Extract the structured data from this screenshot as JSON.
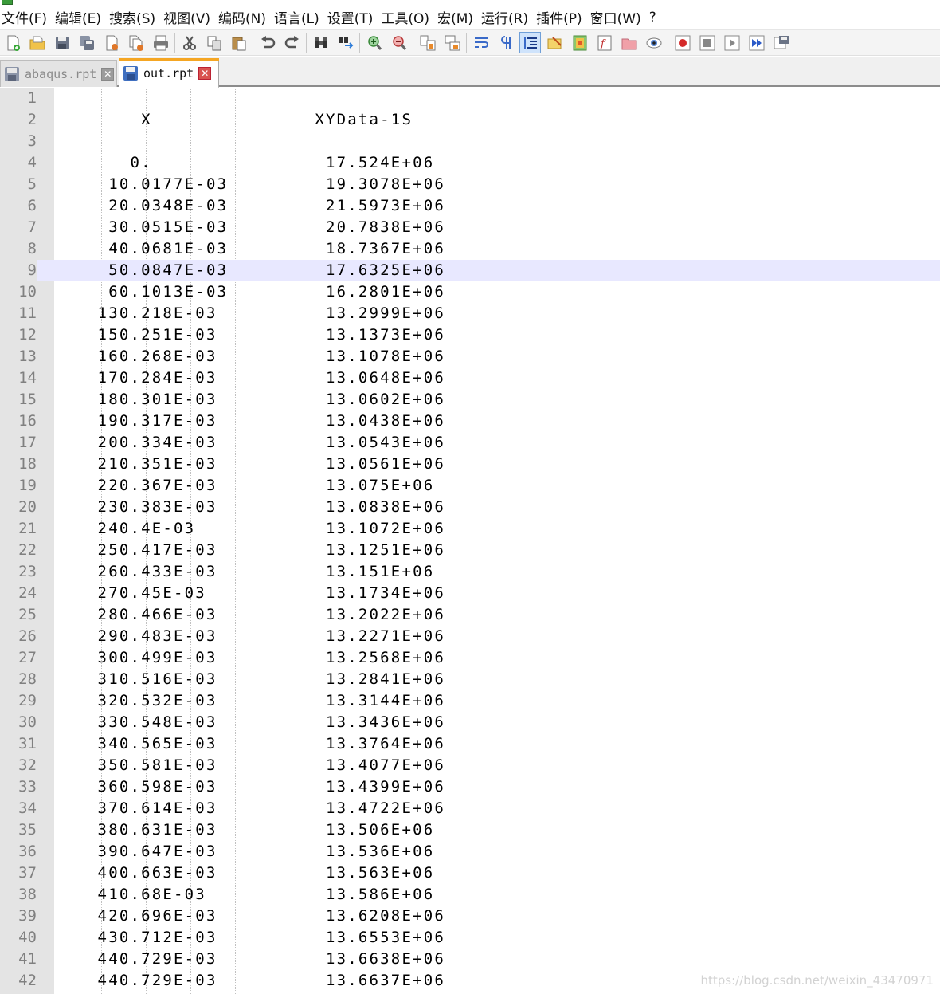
{
  "menu": [
    "文件(F)",
    "编辑(E)",
    "搜索(S)",
    "视图(V)",
    "编码(N)",
    "语言(L)",
    "设置(T)",
    "工具(O)",
    "宏(M)",
    "运行(R)",
    "插件(P)",
    "窗口(W)",
    "?"
  ],
  "toolbar": {
    "groups": [
      [
        "new-file-icon",
        "open-file-icon",
        "save-icon",
        "save-all-icon",
        "close-icon",
        "close-all-icon",
        "print-icon"
      ],
      [
        "cut-icon",
        "copy-icon",
        "paste-icon"
      ],
      [
        "undo-icon",
        "redo-icon"
      ],
      [
        "find-icon",
        "replace-icon"
      ],
      [
        "zoom-in-icon",
        "zoom-out-icon"
      ],
      [
        "sync-vertical-icon",
        "sync-horizontal-icon"
      ],
      [
        "word-wrap-icon",
        "show-all-chars-icon",
        "indent-guide-icon",
        "user-language-icon",
        "document-map-icon",
        "function-list-icon",
        "folder-as-workspace-icon",
        "monitoring-icon"
      ],
      [
        "record-macro-icon",
        "stop-recording-icon",
        "playback-macro-icon",
        "run-macro-multiple-icon",
        "save-macro-icon"
      ]
    ],
    "active": "indent-guide-icon"
  },
  "tabs": [
    {
      "label": "abaqus.rpt",
      "active": false
    },
    {
      "label": "out.rpt",
      "active": true
    }
  ],
  "editor": {
    "current_line": 9,
    "lines": [
      "",
      "        X               XYData-1S",
      "",
      "       0.                17.524E+06",
      "     10.0177E-03         19.3078E+06",
      "     20.0348E-03         21.5973E+06",
      "     30.0515E-03         20.7838E+06",
      "     40.0681E-03         18.7367E+06",
      "     50.0847E-03         17.6325E+06",
      "     60.1013E-03         16.2801E+06",
      "    130.218E-03          13.2999E+06",
      "    150.251E-03          13.1373E+06",
      "    160.268E-03          13.1078E+06",
      "    170.284E-03          13.0648E+06",
      "    180.301E-03          13.0602E+06",
      "    190.317E-03          13.0438E+06",
      "    200.334E-03          13.0543E+06",
      "    210.351E-03          13.0561E+06",
      "    220.367E-03          13.075E+06",
      "    230.383E-03          13.0838E+06",
      "    240.4E-03            13.1072E+06",
      "    250.417E-03          13.1251E+06",
      "    260.433E-03          13.151E+06",
      "    270.45E-03           13.1734E+06",
      "    280.466E-03          13.2022E+06",
      "    290.483E-03          13.2271E+06",
      "    300.499E-03          13.2568E+06",
      "    310.516E-03          13.2841E+06",
      "    320.532E-03          13.3144E+06",
      "    330.548E-03          13.3436E+06",
      "    340.565E-03          13.3764E+06",
      "    350.581E-03          13.4077E+06",
      "    360.598E-03          13.4399E+06",
      "    370.614E-03          13.4722E+06",
      "    380.631E-03          13.506E+06",
      "    390.647E-03          13.536E+06",
      "    400.663E-03          13.563E+06",
      "    410.68E-03           13.586E+06",
      "    420.696E-03          13.6208E+06",
      "    430.712E-03          13.6553E+06",
      "    440.729E-03          13.6638E+06",
      "    440.729E-03          13.6637E+06"
    ]
  },
  "watermark": "https://blog.csdn.net/weixin_43470971",
  "colors": {
    "gutter": "#e4e4e4",
    "current_line": "#e8e8ff",
    "line_number": "#808080",
    "active_tab_accent": "#f5a623"
  }
}
